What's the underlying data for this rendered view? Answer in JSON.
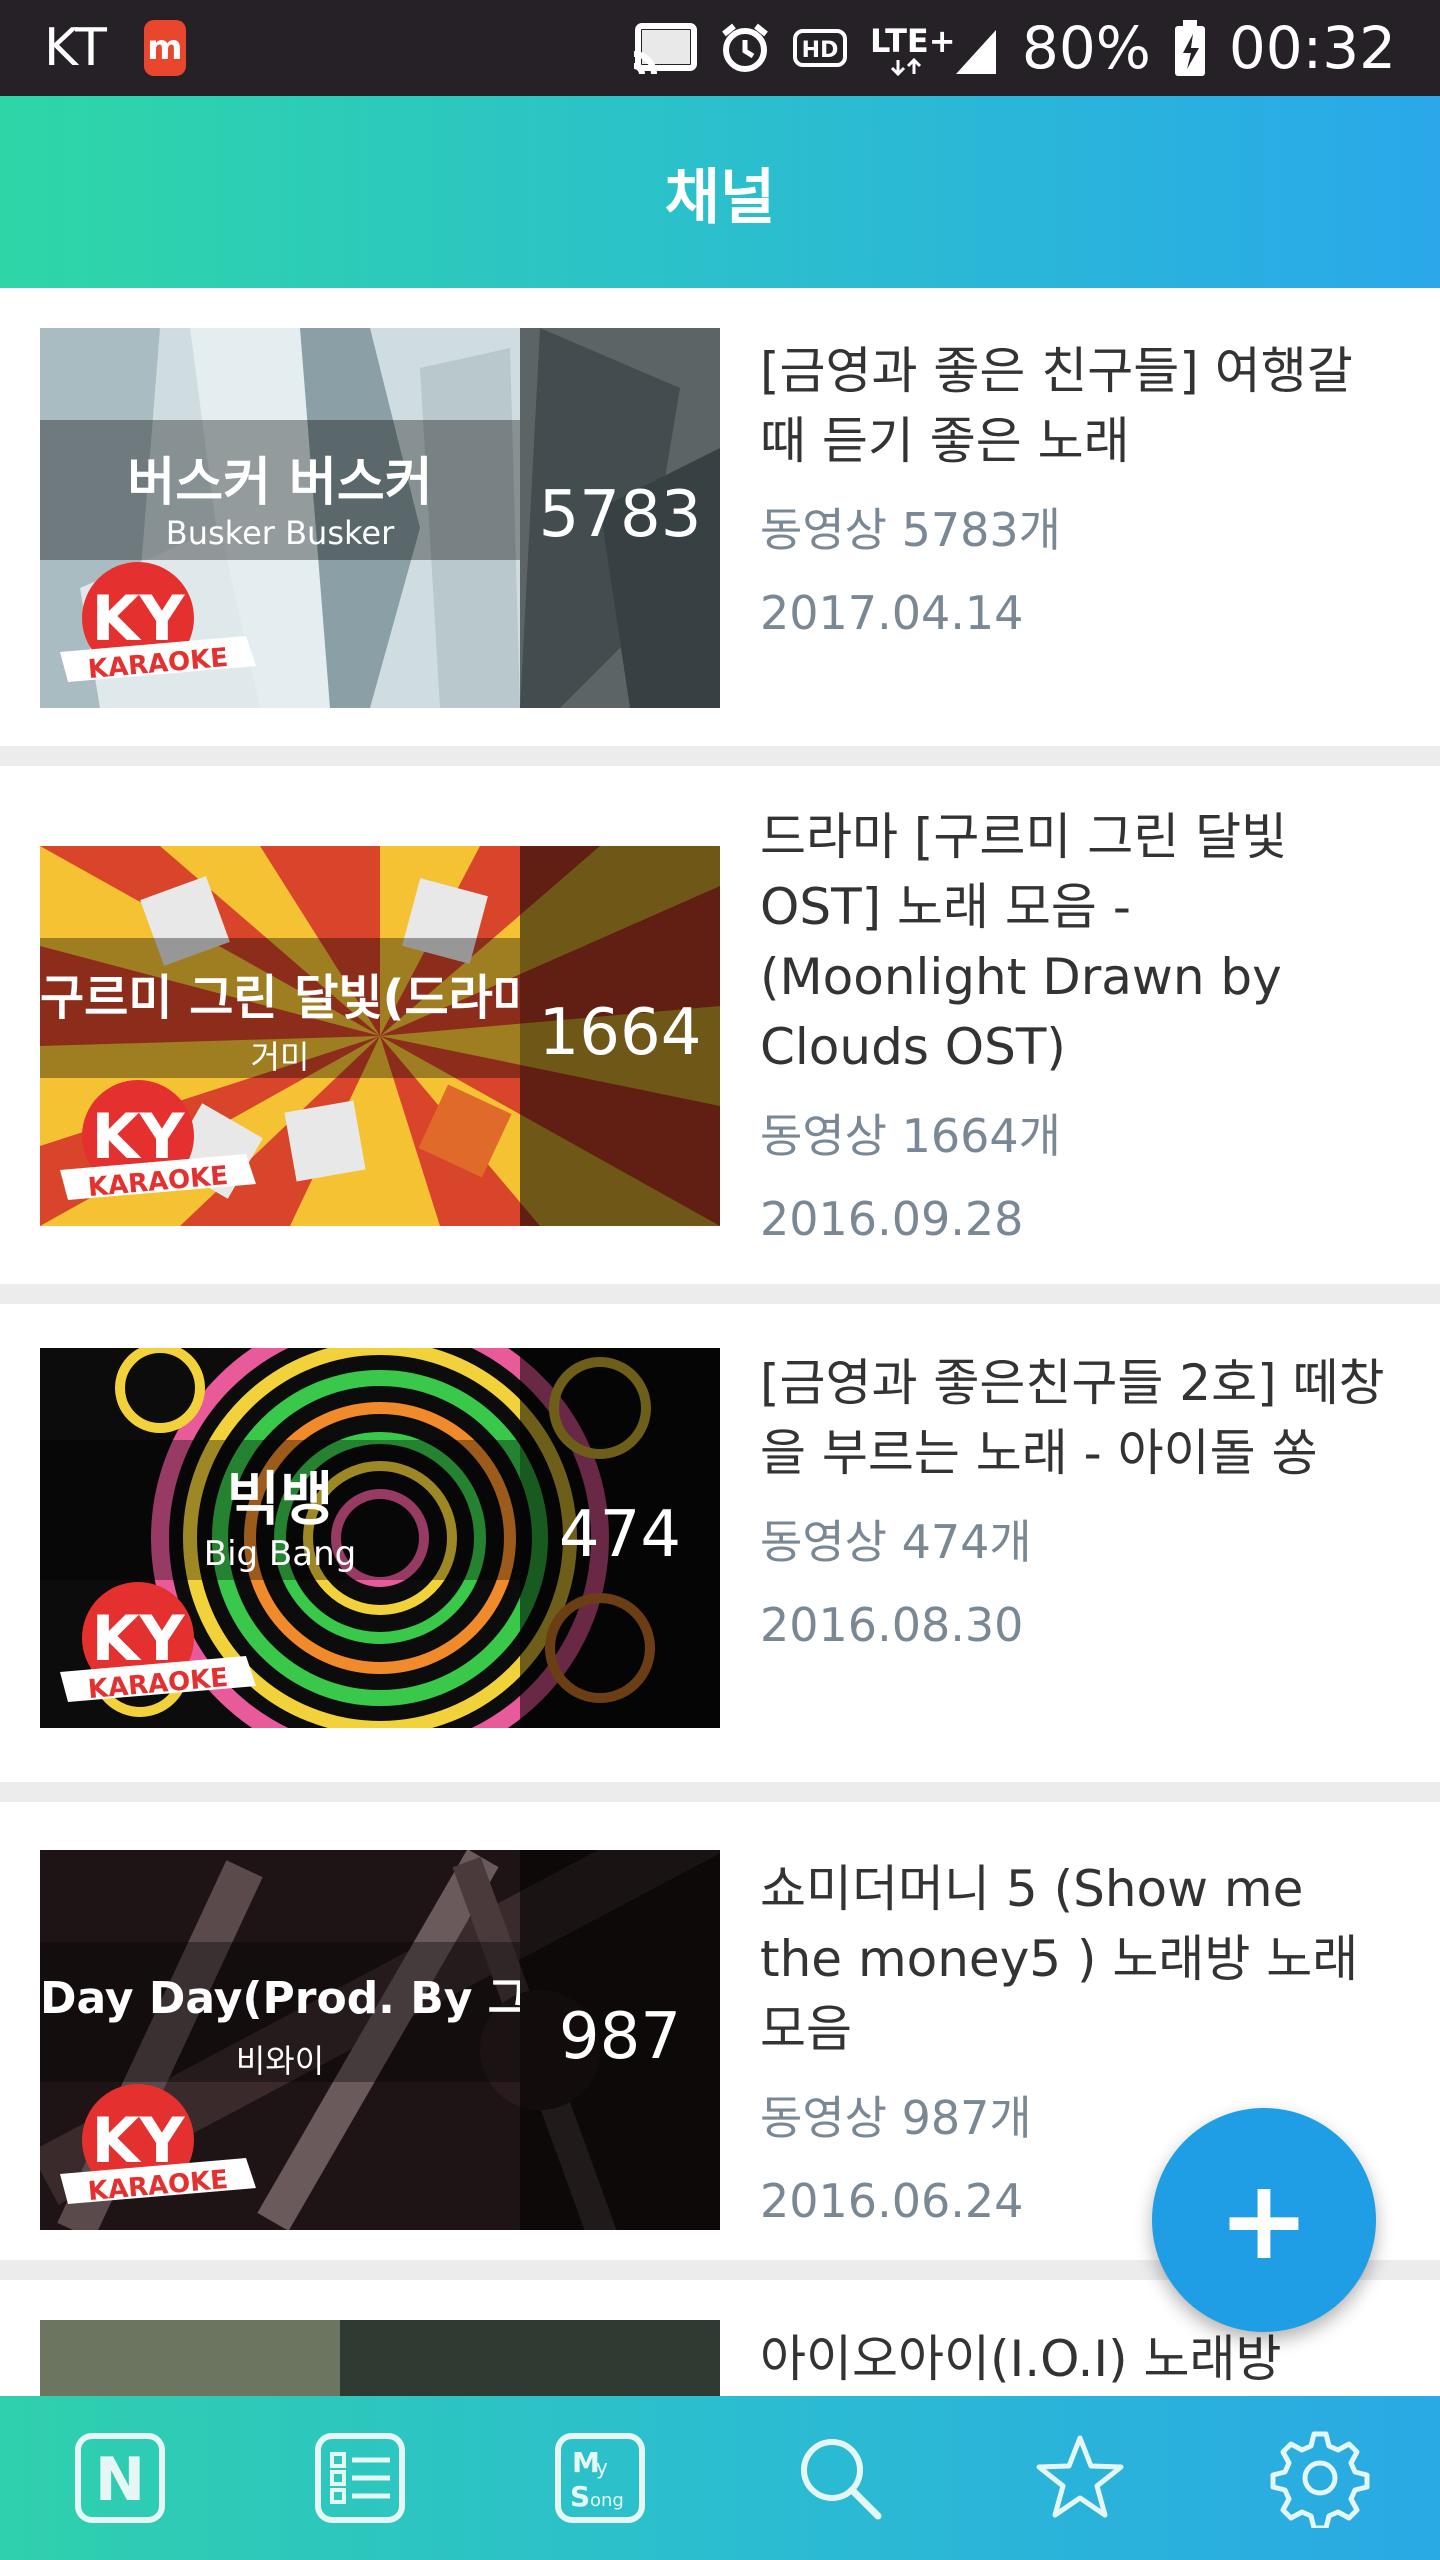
{
  "status_bar": {
    "carrier": "KT",
    "app_icon_letter": "m",
    "battery": "80%",
    "time": "00:32"
  },
  "header": {
    "title": "채널"
  },
  "channels": [
    {
      "thumb_song": "버스커 버스커",
      "thumb_artist": "Busker Busker",
      "thumb_count": "5783",
      "title": "[금영과 좋은 친구들] 여행갈 때 듣기 좋은 노래",
      "count": "동영상 5783개",
      "date": "2017.04.14",
      "theme": "#c9d7d9"
    },
    {
      "thumb_song": "구르미 그린 달빛(드라마 \"구르미 그린 달빛\")",
      "thumb_artist": "거미",
      "thumb_count": "1664",
      "title": "드라마 [구르미 그린 달빛 OST] 노래 모음 - (Moonlight Drawn by Clouds OST)",
      "count": "동영상 1664개",
      "date": "2016.09.28",
      "theme": "#e8a12a"
    },
    {
      "thumb_song": "빅뱅",
      "thumb_artist": "Big Bang",
      "thumb_count": "474",
      "title": "[금영과 좋은친구들 2호] 떼창을 부르는 노래 - 아이돌 쏭",
      "count": "동영상 474개",
      "date": "2016.08.30",
      "theme": "#111111"
    },
    {
      "thumb_song": "Day Day(Prod. By 그레이 (GRAY)) (Feat. 박재범)",
      "thumb_artist": "비와이",
      "thumb_count": "987",
      "title": "쇼미더머니 5 (Show me the money5 ) 노래방 노래모음",
      "count": "동영상 987개",
      "date": "2016.06.24",
      "theme": "#2a1a1c"
    },
    {
      "title": "아이오아이(I.O.I) 노래방",
      "theme": "#4a5a44"
    }
  ],
  "fab": {
    "label": "+"
  },
  "bottom_nav": [
    {
      "icon": "n-icon",
      "label": "N"
    },
    {
      "icon": "list-icon"
    },
    {
      "icon": "my-song-icon",
      "label_top": "My",
      "label_bottom": "Song"
    },
    {
      "icon": "search-icon"
    },
    {
      "icon": "star-icon"
    },
    {
      "icon": "gear-icon"
    }
  ]
}
